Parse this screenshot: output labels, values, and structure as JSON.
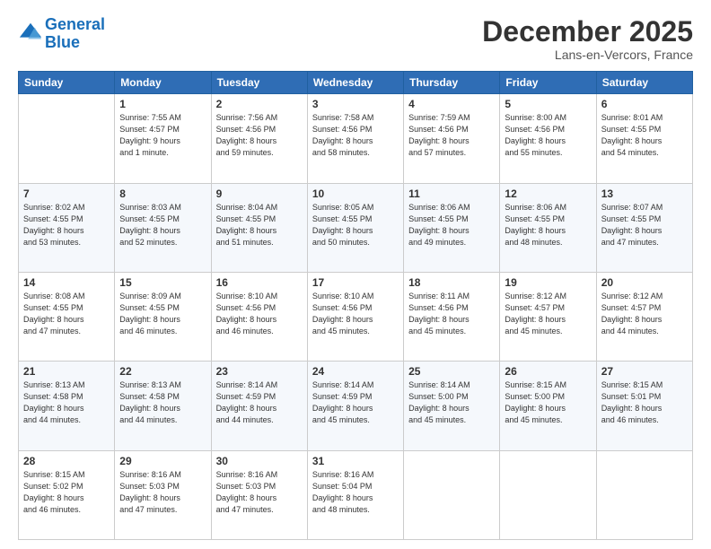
{
  "header": {
    "logo_line1": "General",
    "logo_line2": "Blue",
    "month": "December 2025",
    "location": "Lans-en-Vercors, France"
  },
  "weekdays": [
    "Sunday",
    "Monday",
    "Tuesday",
    "Wednesday",
    "Thursday",
    "Friday",
    "Saturday"
  ],
  "weeks": [
    [
      {
        "day": "",
        "info": ""
      },
      {
        "day": "1",
        "info": "Sunrise: 7:55 AM\nSunset: 4:57 PM\nDaylight: 9 hours\nand 1 minute."
      },
      {
        "day": "2",
        "info": "Sunrise: 7:56 AM\nSunset: 4:56 PM\nDaylight: 8 hours\nand 59 minutes."
      },
      {
        "day": "3",
        "info": "Sunrise: 7:58 AM\nSunset: 4:56 PM\nDaylight: 8 hours\nand 58 minutes."
      },
      {
        "day": "4",
        "info": "Sunrise: 7:59 AM\nSunset: 4:56 PM\nDaylight: 8 hours\nand 57 minutes."
      },
      {
        "day": "5",
        "info": "Sunrise: 8:00 AM\nSunset: 4:56 PM\nDaylight: 8 hours\nand 55 minutes."
      },
      {
        "day": "6",
        "info": "Sunrise: 8:01 AM\nSunset: 4:55 PM\nDaylight: 8 hours\nand 54 minutes."
      }
    ],
    [
      {
        "day": "7",
        "info": "Sunrise: 8:02 AM\nSunset: 4:55 PM\nDaylight: 8 hours\nand 53 minutes."
      },
      {
        "day": "8",
        "info": "Sunrise: 8:03 AM\nSunset: 4:55 PM\nDaylight: 8 hours\nand 52 minutes."
      },
      {
        "day": "9",
        "info": "Sunrise: 8:04 AM\nSunset: 4:55 PM\nDaylight: 8 hours\nand 51 minutes."
      },
      {
        "day": "10",
        "info": "Sunrise: 8:05 AM\nSunset: 4:55 PM\nDaylight: 8 hours\nand 50 minutes."
      },
      {
        "day": "11",
        "info": "Sunrise: 8:06 AM\nSunset: 4:55 PM\nDaylight: 8 hours\nand 49 minutes."
      },
      {
        "day": "12",
        "info": "Sunrise: 8:06 AM\nSunset: 4:55 PM\nDaylight: 8 hours\nand 48 minutes."
      },
      {
        "day": "13",
        "info": "Sunrise: 8:07 AM\nSunset: 4:55 PM\nDaylight: 8 hours\nand 47 minutes."
      }
    ],
    [
      {
        "day": "14",
        "info": "Sunrise: 8:08 AM\nSunset: 4:55 PM\nDaylight: 8 hours\nand 47 minutes."
      },
      {
        "day": "15",
        "info": "Sunrise: 8:09 AM\nSunset: 4:55 PM\nDaylight: 8 hours\nand 46 minutes."
      },
      {
        "day": "16",
        "info": "Sunrise: 8:10 AM\nSunset: 4:56 PM\nDaylight: 8 hours\nand 46 minutes."
      },
      {
        "day": "17",
        "info": "Sunrise: 8:10 AM\nSunset: 4:56 PM\nDaylight: 8 hours\nand 45 minutes."
      },
      {
        "day": "18",
        "info": "Sunrise: 8:11 AM\nSunset: 4:56 PM\nDaylight: 8 hours\nand 45 minutes."
      },
      {
        "day": "19",
        "info": "Sunrise: 8:12 AM\nSunset: 4:57 PM\nDaylight: 8 hours\nand 45 minutes."
      },
      {
        "day": "20",
        "info": "Sunrise: 8:12 AM\nSunset: 4:57 PM\nDaylight: 8 hours\nand 44 minutes."
      }
    ],
    [
      {
        "day": "21",
        "info": "Sunrise: 8:13 AM\nSunset: 4:58 PM\nDaylight: 8 hours\nand 44 minutes."
      },
      {
        "day": "22",
        "info": "Sunrise: 8:13 AM\nSunset: 4:58 PM\nDaylight: 8 hours\nand 44 minutes."
      },
      {
        "day": "23",
        "info": "Sunrise: 8:14 AM\nSunset: 4:59 PM\nDaylight: 8 hours\nand 44 minutes."
      },
      {
        "day": "24",
        "info": "Sunrise: 8:14 AM\nSunset: 4:59 PM\nDaylight: 8 hours\nand 45 minutes."
      },
      {
        "day": "25",
        "info": "Sunrise: 8:14 AM\nSunset: 5:00 PM\nDaylight: 8 hours\nand 45 minutes."
      },
      {
        "day": "26",
        "info": "Sunrise: 8:15 AM\nSunset: 5:00 PM\nDaylight: 8 hours\nand 45 minutes."
      },
      {
        "day": "27",
        "info": "Sunrise: 8:15 AM\nSunset: 5:01 PM\nDaylight: 8 hours\nand 46 minutes."
      }
    ],
    [
      {
        "day": "28",
        "info": "Sunrise: 8:15 AM\nSunset: 5:02 PM\nDaylight: 8 hours\nand 46 minutes."
      },
      {
        "day": "29",
        "info": "Sunrise: 8:16 AM\nSunset: 5:03 PM\nDaylight: 8 hours\nand 47 minutes."
      },
      {
        "day": "30",
        "info": "Sunrise: 8:16 AM\nSunset: 5:03 PM\nDaylight: 8 hours\nand 47 minutes."
      },
      {
        "day": "31",
        "info": "Sunrise: 8:16 AM\nSunset: 5:04 PM\nDaylight: 8 hours\nand 48 minutes."
      },
      {
        "day": "",
        "info": ""
      },
      {
        "day": "",
        "info": ""
      },
      {
        "day": "",
        "info": ""
      }
    ]
  ]
}
